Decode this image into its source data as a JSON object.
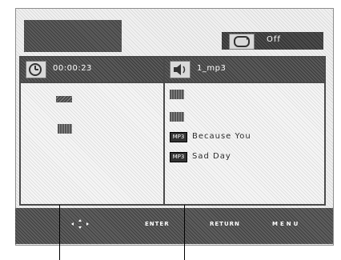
{
  "repeat": {
    "label": "Off"
  },
  "left_panel": {
    "time": "00:00:23"
  },
  "right_panel": {
    "title": "1_mp3",
    "tracks": [
      "Because You",
      "Sad Day"
    ]
  },
  "footer": {
    "enter": "ENTER",
    "return": "RETURN",
    "menu": "MENU"
  }
}
